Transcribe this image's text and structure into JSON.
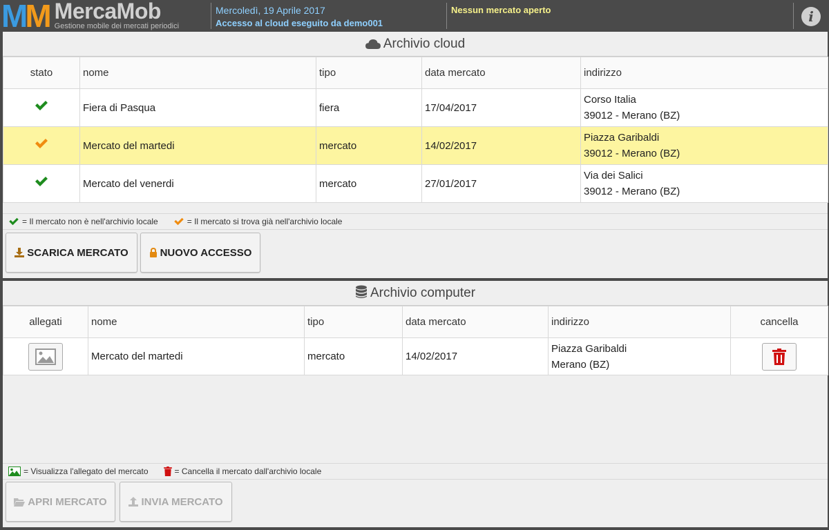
{
  "header": {
    "logo_mark": "MM",
    "logo_title": "MercaMob",
    "logo_subtitle": "Gestione mobile dei mercati periodici",
    "date": "Mercoledì, 19 Aprile 2017",
    "access": "Accesso al cloud eseguito da demo001",
    "market_status": "Nessun mercato aperto",
    "info_label": "i"
  },
  "cloud": {
    "title": "Archivio cloud",
    "columns": [
      "stato",
      "nome",
      "tipo",
      "data mercato",
      "indirizzo"
    ],
    "rows": [
      {
        "status": "green",
        "nome": "Fiera di Pasqua",
        "tipo": "fiera",
        "data": "17/04/2017",
        "addr1": "Corso Italia",
        "addr2": "39012 - Merano (BZ)",
        "highlight": false
      },
      {
        "status": "orange",
        "nome": "Mercato del martedi",
        "tipo": "mercato",
        "data": "14/02/2017",
        "addr1": "Piazza Garibaldi",
        "addr2": "39012 - Merano (BZ)",
        "highlight": true
      },
      {
        "status": "green",
        "nome": "Mercato del venerdi",
        "tipo": "mercato",
        "data": "27/01/2017",
        "addr1": "Via dei Salici",
        "addr2": "39012 - Merano (BZ)",
        "highlight": false
      }
    ],
    "legend_green": "= Il mercato non è nell'archivio locale",
    "legend_orange": "= Il mercato si trova già nell'archivio locale",
    "btn_download": "SCARICA MERCATO",
    "btn_new_access": "NUOVO ACCESSO"
  },
  "computer": {
    "title": "Archivio computer",
    "columns": [
      "allegati",
      "nome",
      "tipo",
      "data mercato",
      "indirizzo",
      "cancella"
    ],
    "rows": [
      {
        "nome": "Mercato del martedi",
        "tipo": "mercato",
        "data": "14/02/2017",
        "addr1": "Piazza Garibaldi",
        "addr2": "Merano (BZ)"
      }
    ],
    "legend_attachment": "= Visualizza l'allegato del mercato",
    "legend_delete": "= Cancella il mercato dall'archivio locale",
    "btn_open": "APRI MERCATO",
    "btn_send": "INVIA MERCATO"
  },
  "colors": {
    "green_check": "#1e8c1e",
    "orange_check": "#f08c10",
    "highlight_row": "#fdf5a0",
    "delete_red": "#d01010",
    "header_bg": "#4a4a4a"
  }
}
